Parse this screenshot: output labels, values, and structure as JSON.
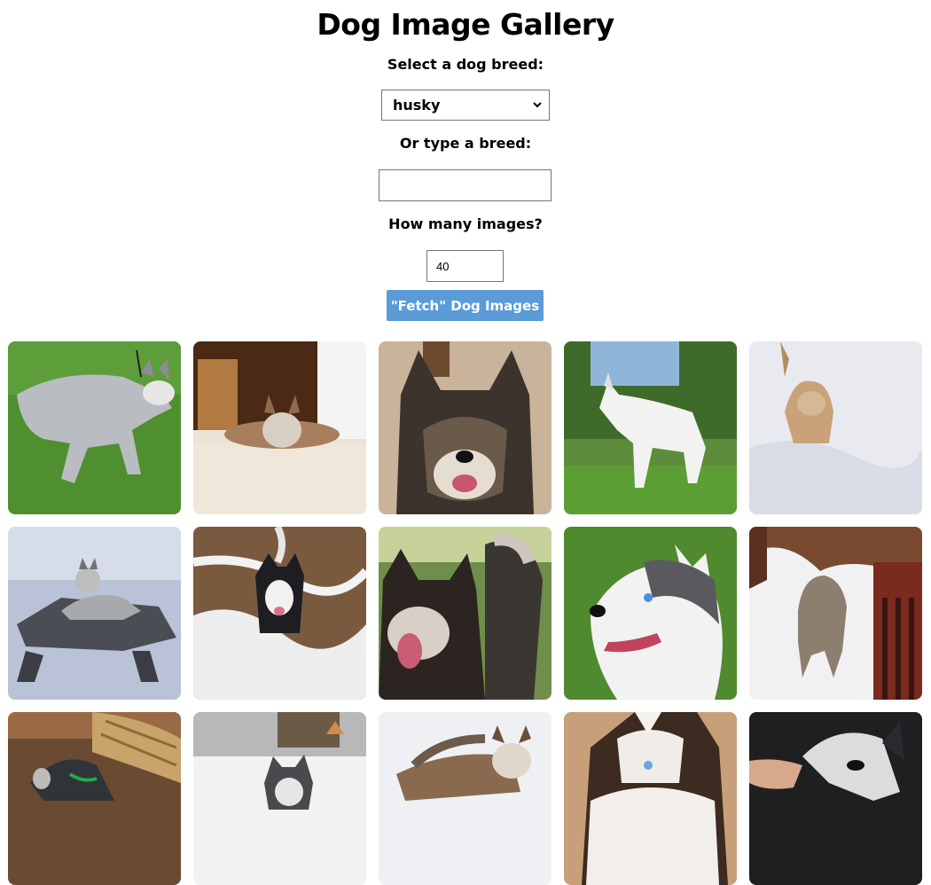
{
  "page": {
    "title": "Dog Image Gallery"
  },
  "form": {
    "select_label": "Select a dog breed:",
    "selected_breed": "husky",
    "type_label": "Or type a breed:",
    "breed_input_value": "",
    "count_label": "How many images?",
    "count_value": "40",
    "fetch_button_label": "\"Fetch\" Dog Images"
  },
  "gallery": {
    "images": [
      {
        "subject": "grey-white husky running on grass"
      },
      {
        "subject": "husky lying on tiled floor"
      },
      {
        "subject": "close-up dark husky face"
      },
      {
        "subject": "white husky standing in yard"
      },
      {
        "subject": "tan husky in snow"
      },
      {
        "subject": "husky on picnic table"
      },
      {
        "subject": "black-white husky in snowy brush"
      },
      {
        "subject": "black husky with tongue out"
      },
      {
        "subject": "husky head profile on grass"
      },
      {
        "subject": "husky in snow by fence"
      },
      {
        "subject": "husky near wicker basket"
      },
      {
        "subject": "husky in snow"
      },
      {
        "subject": "husky lying in snow"
      },
      {
        "subject": "brown-white husky face"
      },
      {
        "subject": "black husky being petted"
      }
    ]
  }
}
